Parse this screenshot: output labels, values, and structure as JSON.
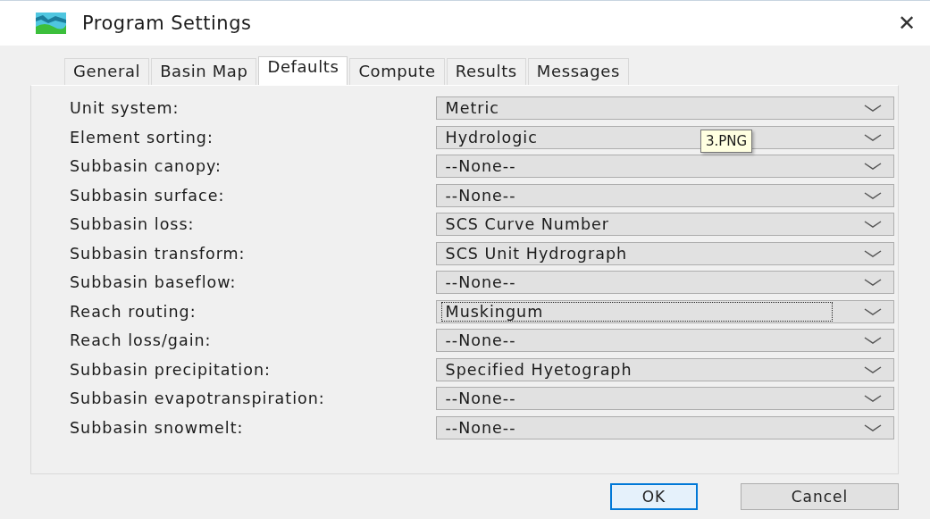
{
  "window": {
    "title": "Program Settings",
    "close": "✕"
  },
  "tabs": [
    {
      "label": "General",
      "selected": false
    },
    {
      "label": "Basin Map",
      "selected": false
    },
    {
      "label": "Defaults",
      "selected": true
    },
    {
      "label": "Compute",
      "selected": false
    },
    {
      "label": "Results",
      "selected": false
    },
    {
      "label": "Messages",
      "selected": false
    }
  ],
  "settings": [
    {
      "label": "Unit system:",
      "value": "Metric",
      "focused": false
    },
    {
      "label": "Element sorting:",
      "value": "Hydrologic",
      "focused": false
    },
    {
      "label": "Subbasin canopy:",
      "value": "--None--",
      "focused": false
    },
    {
      "label": "Subbasin surface:",
      "value": "--None--",
      "focused": false
    },
    {
      "label": "Subbasin loss:",
      "value": "SCS Curve Number",
      "focused": false
    },
    {
      "label": "Subbasin transform:",
      "value": "SCS Unit Hydrograph",
      "focused": false
    },
    {
      "label": "Subbasin baseflow:",
      "value": "--None--",
      "focused": false
    },
    {
      "label": "Reach routing:",
      "value": "Muskingum",
      "focused": true
    },
    {
      "label": "Reach loss/gain:",
      "value": "--None--",
      "focused": false
    },
    {
      "label": "Subbasin precipitation:",
      "value": "Specified Hyetograph",
      "focused": false
    },
    {
      "label": "Subbasin evapotranspiration:",
      "value": "--None--",
      "focused": false
    },
    {
      "label": "Subbasin snowmelt:",
      "value": "--None--",
      "focused": false
    }
  ],
  "tooltip": "3.PNG",
  "buttons": [
    {
      "label": "OK",
      "default": true
    },
    {
      "label": "Cancel",
      "default": false
    }
  ]
}
